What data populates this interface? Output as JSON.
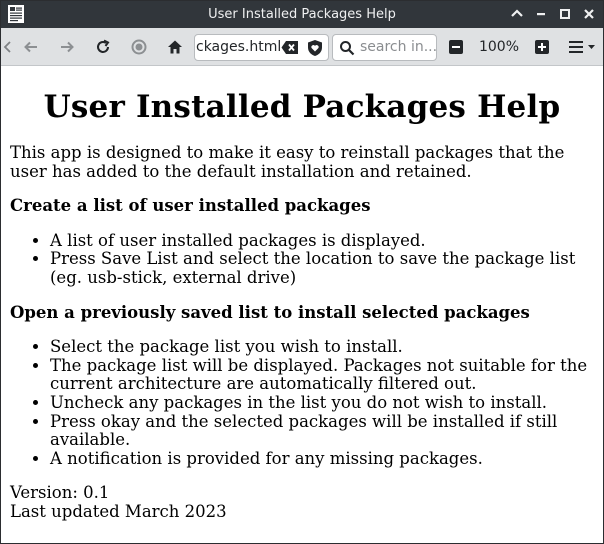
{
  "window": {
    "title": "User Installed Packages Help"
  },
  "toolbar": {
    "url_text": "ckages.html",
    "search_placeholder": "search in...",
    "zoom_level": "100%"
  },
  "icons": {
    "back": "arrow-left-icon",
    "forward": "arrow-right-icon",
    "reload": "reload-icon",
    "stop": "stop-icon",
    "home": "home-icon",
    "clear": "backspace-icon",
    "shield": "shield-heart-icon",
    "search": "search-icon",
    "zoom_out": "minus-icon",
    "zoom_in": "plus-icon",
    "menu": "hamburger-menu-icon"
  },
  "page": {
    "heading": "User Installed Packages Help",
    "intro": "This app is designed to make it easy to reinstall packages that the user has added to the default installation and retained.",
    "section1": {
      "title": "Create a list of user installed packages",
      "items": [
        "A list of user installed packages is displayed.",
        "Press Save List and select the location to save the package list (eg. usb-stick, external drive)"
      ]
    },
    "section2": {
      "title": "Open a previously saved list to install selected packages",
      "items": [
        "Select the package list you wish to install.",
        "The package list will be displayed. Packages not suitable for the current architecture are automatically filtered out.",
        "Uncheck any packages in the list you do not wish to install.",
        "Press okay and the selected packages will be installed if still available.",
        "A notification is provided for any missing packages."
      ]
    },
    "version": "Version: 0.1",
    "last_updated": "Last updated March 2023"
  },
  "colors": {
    "titlebar_bg": "#31363b",
    "toolbar_bg": "#dfe1e3",
    "page_bg": "#ffffff",
    "text": "#000000"
  }
}
